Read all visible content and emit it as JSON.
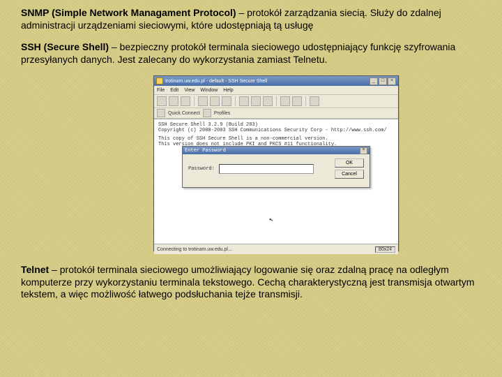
{
  "para1": {
    "bold": "SNMP (Simple Network Managament Protocol)",
    "rest": " – protokół zarządzania siecią. Służy do zdalnej administracji urządzeniami sieciowymi, które udostępniają tą usługę"
  },
  "para2": {
    "bold": "SSH (Secure Shell)",
    "rest": " – bezpieczny protokół terminala sieciowego udostępniający funkcję szyfrowania przesyłanych danych. Jest zalecany do wykorzystania zamiast Telnetu."
  },
  "para3": {
    "bold": "Telnet",
    "rest": " – protokół terminala sieciowego umożliwiający logowanie się oraz zdalną pracę na odległym komputerze przy wykorzystaniu terminala tekstowego. Cechą charakterystyczną jest transmisja otwartym tekstem, a więc możliwość łatwego podsłuchania tejże transmisji."
  },
  "sshwin": {
    "title": "trotinam.uw.edu.pl - default - SSH Secure Shell",
    "menu": [
      "File",
      "Edit",
      "View",
      "Window",
      "Help"
    ],
    "quick": [
      "Quick Connect",
      "Profiles"
    ],
    "term_line1": "SSH Secure Shell 3.2.9 (Build 283)",
    "term_line2": "Copyright (c) 2000-2003 SSH Communications Security Corp - http://www.ssh.com/",
    "term_line3": "This copy of SSH Secure Shell is a non-commercial version.",
    "term_line4": "This version does not include PKI and PKCS #11 functionality.",
    "dialog_title": "Enter Password",
    "dialog_password_label": "Password:",
    "dialog_ok": "OK",
    "dialog_cancel": "Cancel",
    "status_left": "Connecting to trotinam.uw.edu.pl…",
    "status_right": "80x24"
  }
}
